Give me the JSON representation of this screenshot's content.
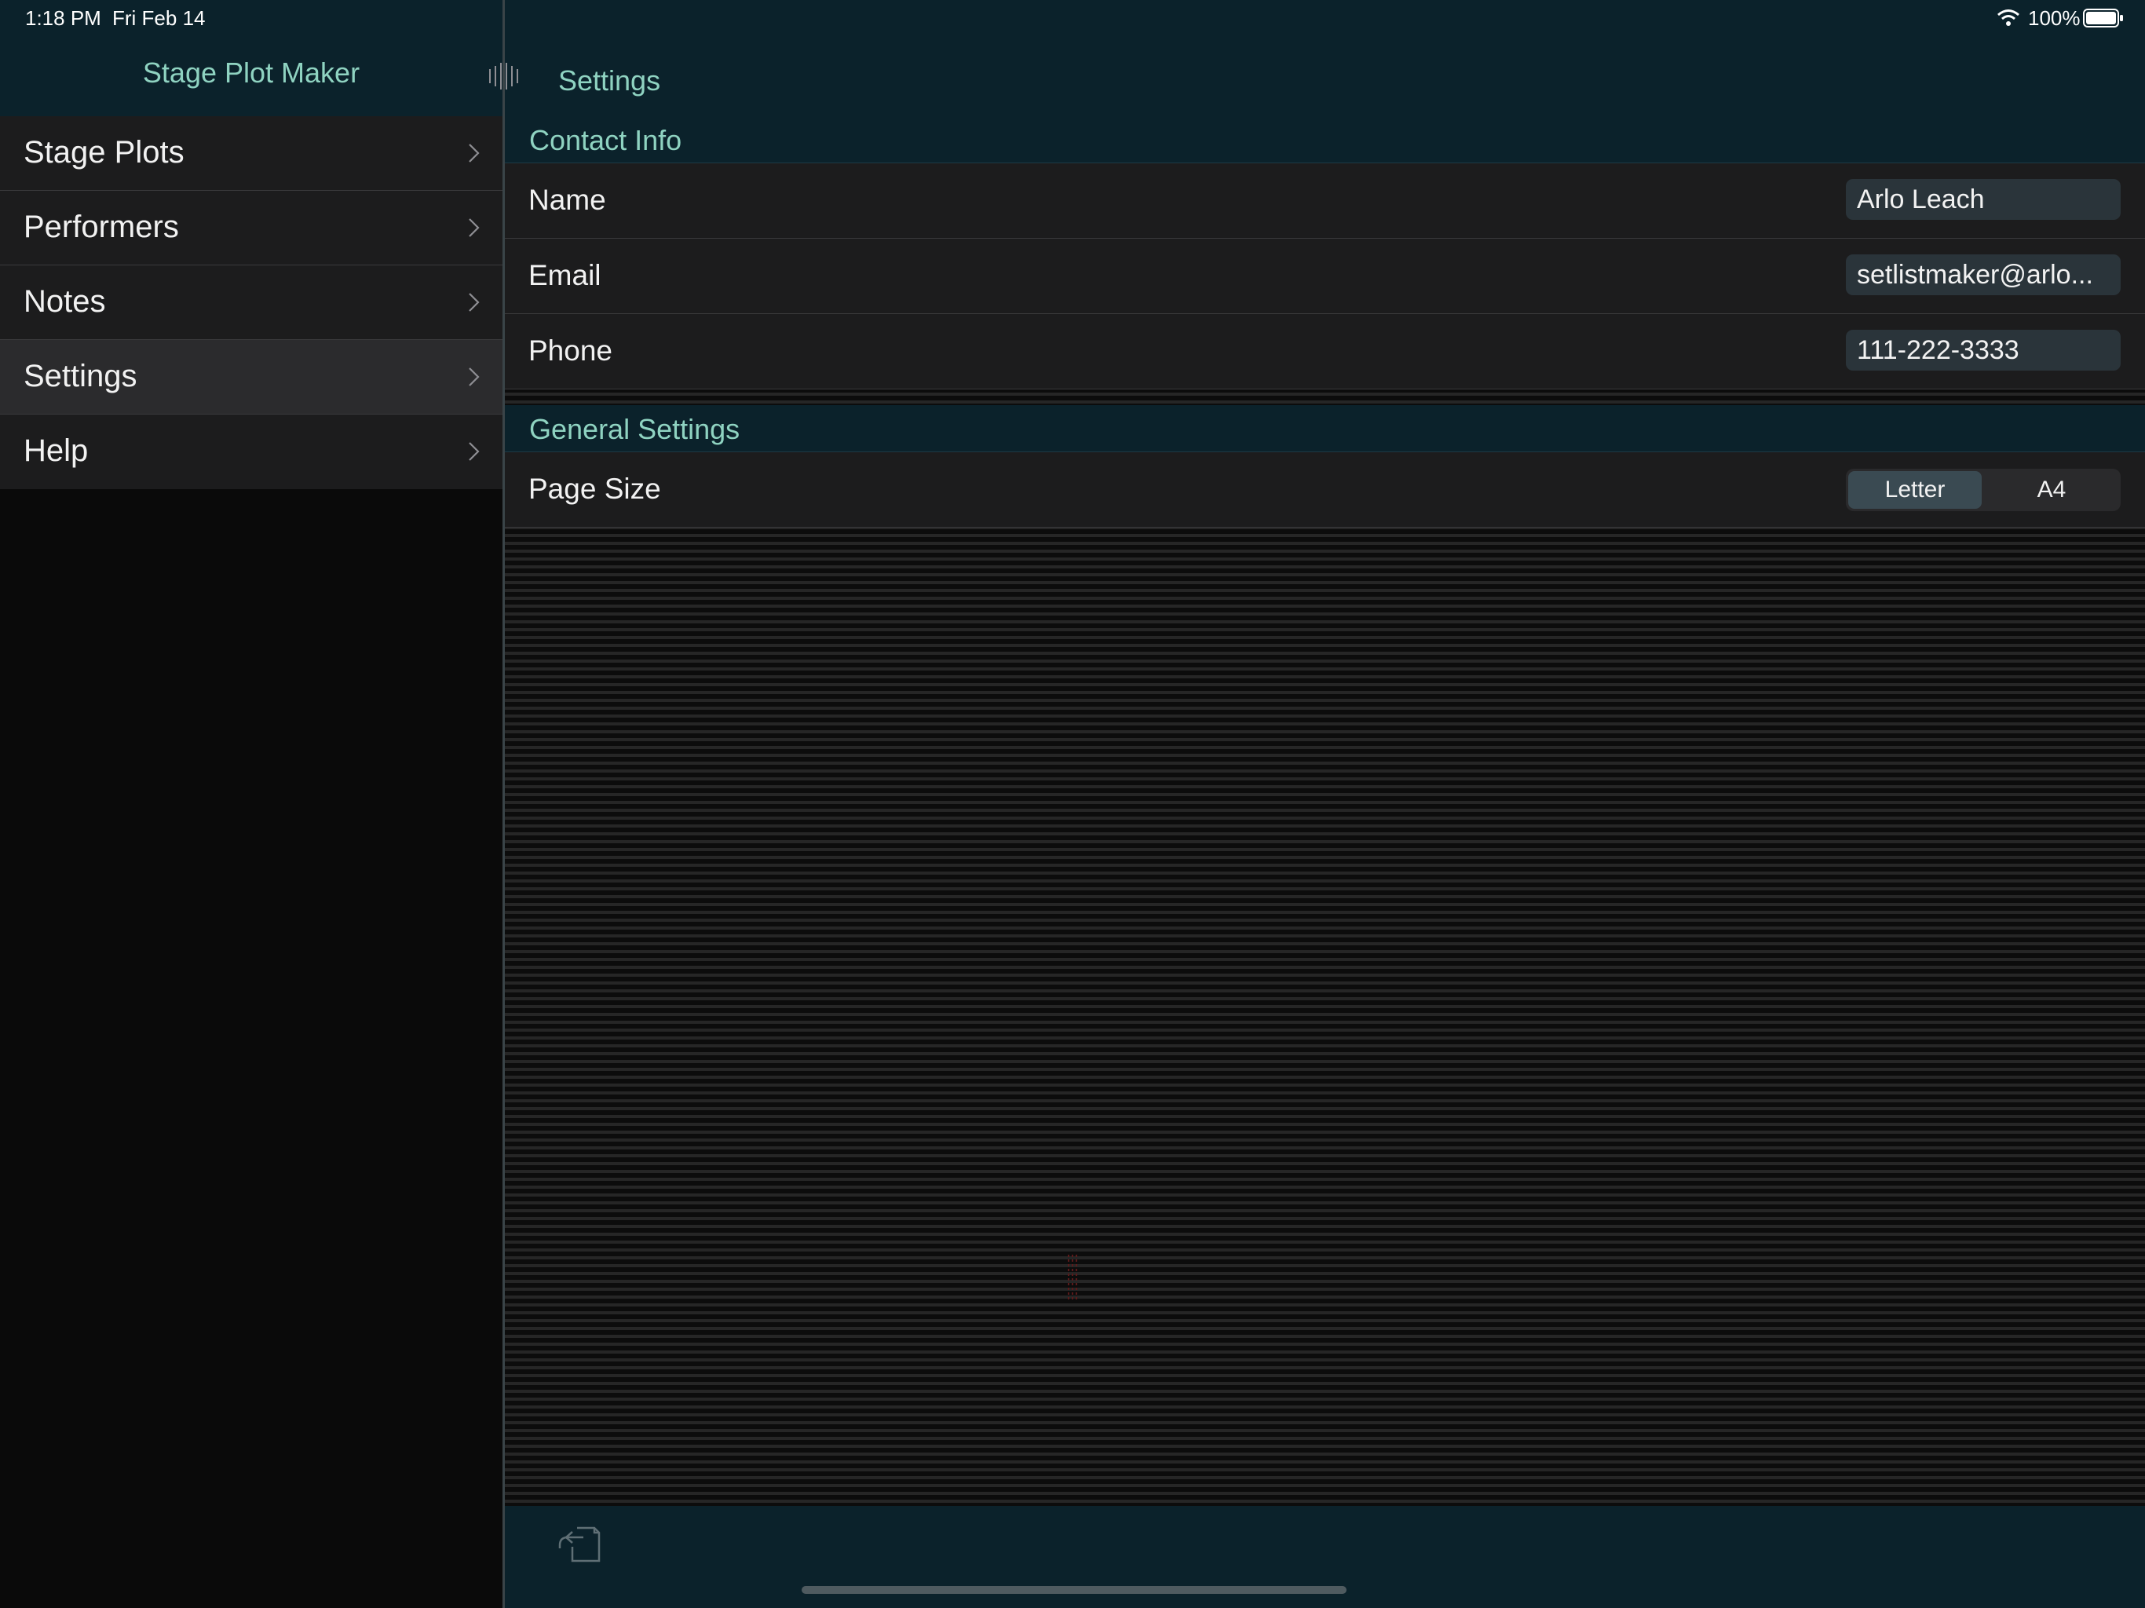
{
  "status_bar": {
    "time": "1:18 PM",
    "date": "Fri Feb 14",
    "battery": "100%"
  },
  "sidebar": {
    "title": "Stage Plot Maker",
    "items": [
      {
        "label": "Stage Plots",
        "selected": false
      },
      {
        "label": "Performers",
        "selected": false
      },
      {
        "label": "Notes",
        "selected": false
      },
      {
        "label": "Settings",
        "selected": true
      },
      {
        "label": "Help",
        "selected": false
      }
    ]
  },
  "detail": {
    "title": "Settings",
    "contact_section": {
      "header": "Contact Info",
      "fields": [
        {
          "label": "Name",
          "value": "Arlo Leach"
        },
        {
          "label": "Email",
          "value": "setlistmaker@arlo..."
        },
        {
          "label": "Phone",
          "value": "111-222-3333"
        }
      ]
    },
    "general_section": {
      "header": "General Settings",
      "page_size": {
        "label": "Page Size",
        "options": [
          "Letter",
          "A4"
        ],
        "selected": "Letter"
      }
    }
  },
  "icons": {
    "chevron": "chevron-right-icon",
    "split": "split-view-handle-icon",
    "share": "share-icon",
    "wifi": "wifi-icon",
    "battery": "battery-icon"
  },
  "colors": {
    "accent": "#8fd3c1",
    "nav_background": "#0b222b",
    "row_background": "#1c1c1d",
    "selected_row": "#2b2b2d"
  }
}
